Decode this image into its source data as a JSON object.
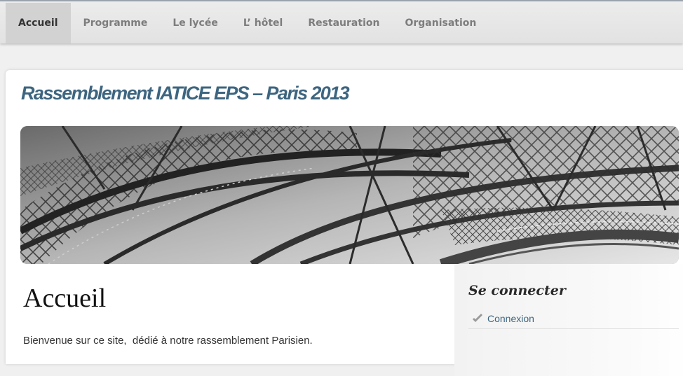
{
  "nav": {
    "items": [
      {
        "label": "Accueil",
        "active": true
      },
      {
        "label": "Programme",
        "active": false
      },
      {
        "label": "Le lycée",
        "active": false
      },
      {
        "label": "L’ hôtel",
        "active": false
      },
      {
        "label": "Restauration",
        "active": false
      },
      {
        "label": "Organisation",
        "active": false
      }
    ]
  },
  "site": {
    "title": "Rassemblement IATICE EPS – Paris 2013"
  },
  "banner": {
    "icon": "eiffel-tower-photo"
  },
  "content": {
    "heading": "Accueil",
    "intro": "Bienvenue sur ce site,  dédié à notre rassemblement Parisien."
  },
  "sidebar": {
    "title": "Se connecter",
    "links": [
      {
        "label": "Connexion",
        "icon": "check-icon"
      }
    ]
  },
  "colors": {
    "title": "#3d6580",
    "link": "#3d6580",
    "nav_active_bg": "#d2d2d2"
  }
}
